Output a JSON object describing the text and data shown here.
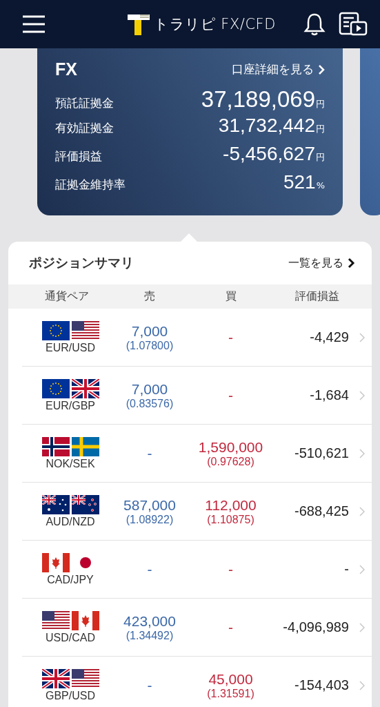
{
  "header": {
    "brand": "トラリピ FX/CFD"
  },
  "account_card": {
    "title": "FX",
    "link": "口座詳細を見る",
    "rows": [
      {
        "label": "預託証拠金",
        "value": "37,189,069",
        "unit": "円",
        "kind": "large"
      },
      {
        "label": "有効証拠金",
        "value": "31,732,442",
        "unit": "円",
        "kind": "normal"
      },
      {
        "label": "評価損益",
        "value": "-5,456,627",
        "unit": "円",
        "kind": "normal"
      },
      {
        "label": "証拠金維持率",
        "value": "521",
        "unit": "%",
        "kind": "normal"
      }
    ]
  },
  "position_summary": {
    "title": "ポジションサマリ",
    "link": "一覧を見る",
    "columns": [
      "通貨ペア",
      "売",
      "買",
      "評価損益"
    ],
    "rows": [
      {
        "pair": "EUR/USD",
        "flags": [
          {
            "kind": "eu"
          },
          {
            "kind": "us"
          }
        ],
        "sell": "7,000",
        "sell_rate": "(1.07800)",
        "buy": "-",
        "pl": "-4,429"
      },
      {
        "pair": "EUR/GBP",
        "flags": [
          {
            "kind": "eu"
          },
          {
            "kind": "gb"
          }
        ],
        "sell": "7,000",
        "sell_rate": "(0.83576)",
        "buy": "-",
        "pl": "-1,684"
      },
      {
        "pair": "NOK/SEK",
        "flags": [
          {
            "kind": "no"
          },
          {
            "kind": "se"
          }
        ],
        "sell": "-",
        "buy": "1,590,000",
        "buy_rate": "(0.97628)",
        "pl": "-510,621"
      },
      {
        "pair": "AUD/NZD",
        "flags": [
          {
            "kind": "au"
          },
          {
            "kind": "nz"
          }
        ],
        "sell": "587,000",
        "sell_rate": "(1.08922)",
        "buy": "112,000",
        "buy_rate": "(1.10875)",
        "pl": "-688,425"
      },
      {
        "pair": "CAD/JPY",
        "flags": [
          {
            "kind": "ca"
          },
          {
            "kind": "jp"
          }
        ],
        "sell": "-",
        "buy": "-",
        "pl": "-"
      },
      {
        "pair": "USD/CAD",
        "flags": [
          {
            "kind": "us"
          },
          {
            "kind": "ca"
          }
        ],
        "sell": "423,000",
        "sell_rate": "(1.34492)",
        "buy": "-",
        "pl": "-4,096,989"
      },
      {
        "pair": "GBP/USD",
        "flags": [
          {
            "kind": "gb"
          },
          {
            "kind": "us"
          }
        ],
        "sell": "-",
        "buy": "45,000",
        "buy_rate": "(1.31591)",
        "pl": "-154,403"
      }
    ]
  }
}
